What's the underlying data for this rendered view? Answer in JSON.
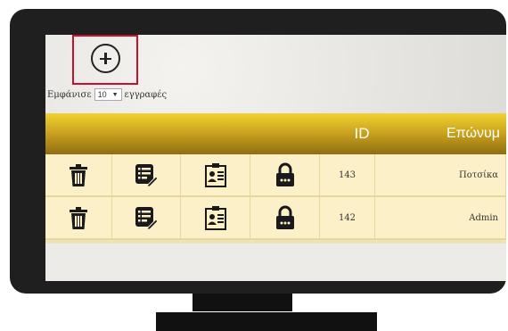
{
  "add_button": {
    "icon": "plus-circle-icon"
  },
  "show_entries": {
    "prefix": "Εμφάνισε",
    "selected": "10",
    "suffix": "εγγραφές"
  },
  "table": {
    "columns": [
      "",
      "",
      "",
      "",
      "ID",
      "Επώνυμ"
    ],
    "rows": [
      {
        "id": "143",
        "last_name": "Ποτσίκα"
      },
      {
        "id": "142",
        "last_name": "Admin"
      }
    ],
    "row_icons": [
      "trash-icon",
      "edit-icon",
      "id-card-icon",
      "lock-icon"
    ]
  }
}
